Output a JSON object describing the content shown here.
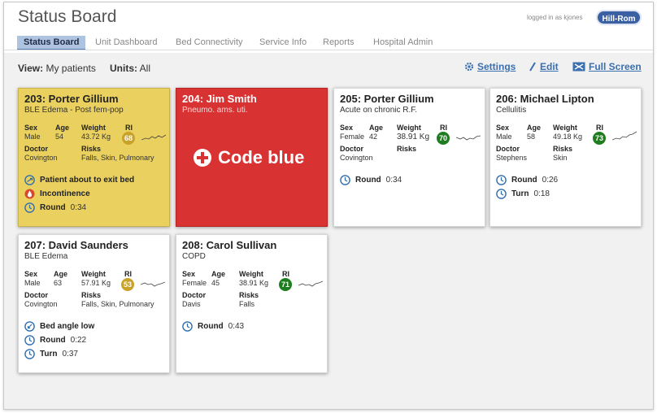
{
  "app": {
    "title": "Status Board",
    "logged_in": "logged in as kjones",
    "brand": "Hill-Rom"
  },
  "tabs": [
    {
      "label": "Status Board",
      "active": true
    },
    {
      "label": "Unit Dashboard",
      "active": false
    },
    {
      "label": "Bed Connectivity",
      "active": false
    },
    {
      "label": "Service Info",
      "active": false
    },
    {
      "label": "Reports",
      "active": false
    },
    {
      "label": "Hospital Admin",
      "active": false
    }
  ],
  "toolbar": {
    "view_label": "View:",
    "view_value": "My patients",
    "units_label": "Units:",
    "units_value": "All",
    "settings_label": "Settings",
    "edit_label": "Edit",
    "fullscreen_label": "Full Screen"
  },
  "field_labels": {
    "sex": "Sex",
    "age": "Age",
    "weight": "Weight",
    "ri": "RI",
    "doctor": "Doctor",
    "risks": "Risks"
  },
  "colors": {
    "ri_green": "#1e7d1e",
    "ri_yellow": "#c9a22a",
    "alert_blue": "#2f6fb2",
    "code_red": "#d93232",
    "alert_yellow": "#ead15f"
  },
  "cards": [
    {
      "room": "203: Porter Gillium",
      "diagnosis": "BLE Edema - Post fem-pop",
      "sex": "Male",
      "age": "54",
      "weight": "43.72 Kg",
      "ri": "68",
      "ri_status": "yellow",
      "doctor": "Covington",
      "risks": "Falls, Skin, Pulmonary",
      "alerts": [
        {
          "icon": "bed-exit-icon",
          "label": "Patient about to exit bed",
          "time": ""
        },
        {
          "icon": "incontinence-icon",
          "label": "Incontinence",
          "time": ""
        },
        {
          "icon": "clock-icon",
          "label": "Round",
          "time": "0:34"
        }
      ]
    },
    {
      "room": "204: Jim Smith",
      "diagnosis": "Pneumo. ams. uti.",
      "code": "Code blue"
    },
    {
      "room": "205: Porter Gillium",
      "diagnosis": "Acute on chronic R.F.",
      "sex": "Female",
      "age": "42",
      "weight": "38.91 Kg",
      "ri": "70",
      "ri_status": "green",
      "doctor": "Covington",
      "risks": "",
      "alerts": [
        {
          "icon": "clock-icon",
          "label": "Round",
          "time": "0:34"
        }
      ]
    },
    {
      "room": "206: Michael Lipton",
      "diagnosis": "Cellulitis",
      "sex": "Male",
      "age": "58",
      "weight": "49.18 Kg",
      "ri": "73",
      "ri_status": "green",
      "doctor": "Stephens",
      "risks": "Skin",
      "alerts": [
        {
          "icon": "clock-icon",
          "label": "Round",
          "time": "0:26"
        },
        {
          "icon": "clock-icon",
          "label": "Turn",
          "time": "0:18"
        }
      ]
    },
    {
      "room": "207: David Saunders",
      "diagnosis": "BLE Edema",
      "sex": "Male",
      "age": "63",
      "weight": "57.91 Kg",
      "ri": "53",
      "ri_status": "yellow",
      "doctor": "Covington",
      "risks": "Falls, Skin, Pulmonary",
      "alerts": [
        {
          "icon": "bed-angle-icon",
          "label": "Bed angle low",
          "time": ""
        },
        {
          "icon": "clock-icon",
          "label": "Round",
          "time": "0:22"
        },
        {
          "icon": "clock-icon",
          "label": "Turn",
          "time": "0:37"
        }
      ]
    },
    {
      "room": "208: Carol Sullivan",
      "diagnosis": "COPD",
      "sex": "Female",
      "age": "45",
      "weight": "38.91 Kg",
      "ri": "71",
      "ri_status": "green",
      "doctor": "Davis",
      "risks": "Falls",
      "alerts": [
        {
          "icon": "clock-icon",
          "label": "Round",
          "time": "0:43"
        }
      ]
    }
  ]
}
